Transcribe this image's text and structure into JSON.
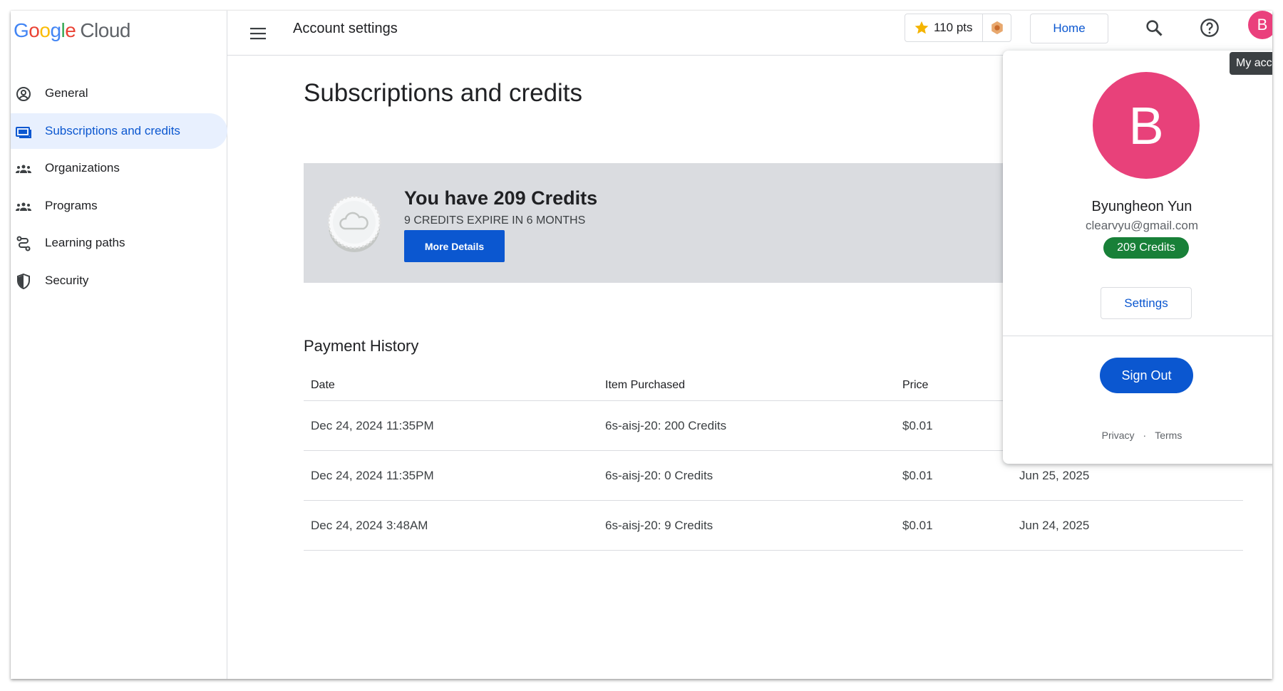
{
  "app": {
    "logo_google": [
      "G",
      "o",
      "o",
      "g",
      "l",
      "e"
    ],
    "logo_cloud": "Cloud"
  },
  "sidebar": {
    "items": [
      {
        "label": "General",
        "icon": "account-circle-icon",
        "active": false
      },
      {
        "label": "Subscriptions and credits",
        "icon": "credit-card-icon",
        "active": true
      },
      {
        "label": "Organizations",
        "icon": "group-icon",
        "active": false
      },
      {
        "label": "Programs",
        "icon": "group-icon",
        "active": false
      },
      {
        "label": "Learning paths",
        "icon": "route-icon",
        "active": false
      },
      {
        "label": "Security",
        "icon": "shield-icon",
        "active": false
      }
    ]
  },
  "header": {
    "title": "Account settings",
    "points_label": "110 pts",
    "home_label": "Home",
    "avatar_letter": "B",
    "tooltip": "My acco"
  },
  "main": {
    "title": "Subscriptions and credits",
    "credits_card": {
      "title": "You have 209 Credits",
      "expire": "9 CREDITS EXPIRE IN 6 MONTHS",
      "button": "More Details"
    },
    "payment_history": {
      "title": "Payment History",
      "columns": [
        "Date",
        "Item Purchased",
        "Price",
        ""
      ],
      "rows": [
        {
          "date": "Dec 24, 2024 11:35PM",
          "item": "6s-aisj-20: 200 Credits",
          "price": "$0.01",
          "expiry": ""
        },
        {
          "date": "Dec 24, 2024 11:35PM",
          "item": "6s-aisj-20: 0 Credits",
          "price": "$0.01",
          "expiry": "Jun 25, 2025"
        },
        {
          "date": "Dec 24, 2024 3:48AM",
          "item": "6s-aisj-20: 9 Credits",
          "price": "$0.01",
          "expiry": "Jun 24, 2025"
        }
      ]
    }
  },
  "account_menu": {
    "avatar_letter": "B",
    "name": "Byungheon Yun",
    "email": "clearvyu@gmail.com",
    "credits": "209 Credits",
    "settings_label": "Settings",
    "signout_label": "Sign Out",
    "privacy_label": "Privacy",
    "separator": "·",
    "terms_label": "Terms"
  },
  "colors": {
    "accent": "#0b57d0",
    "avatar": "#e8417a",
    "credits_badge": "#188038",
    "card_bg": "#dadce0"
  }
}
